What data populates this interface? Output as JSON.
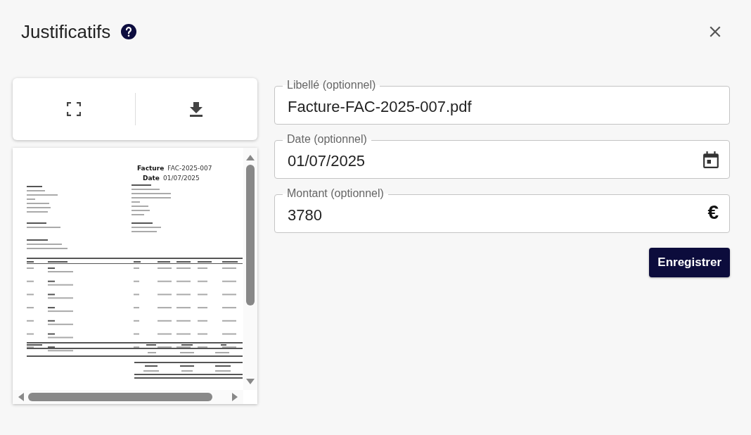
{
  "dialog": {
    "title": "Justificatifs"
  },
  "document": {
    "kind": "picture",
    "header": [
      {
        "label": "Facture",
        "value": "FAC-2025-007"
      },
      {
        "label": "Date",
        "value": "01/07/2025"
      }
    ]
  },
  "fields": [
    {
      "kind": "text",
      "label": "Libellé (optionnel)",
      "value": "Facture-FAC-2025-007.pdf"
    },
    {
      "kind": "date",
      "label": "Date (optionnel)",
      "value": "01/07/2025"
    },
    {
      "kind": "amount",
      "label": "Montant (optionnel)",
      "value": "3780",
      "suffix": "€"
    }
  ],
  "save_button": "Enregistrer"
}
